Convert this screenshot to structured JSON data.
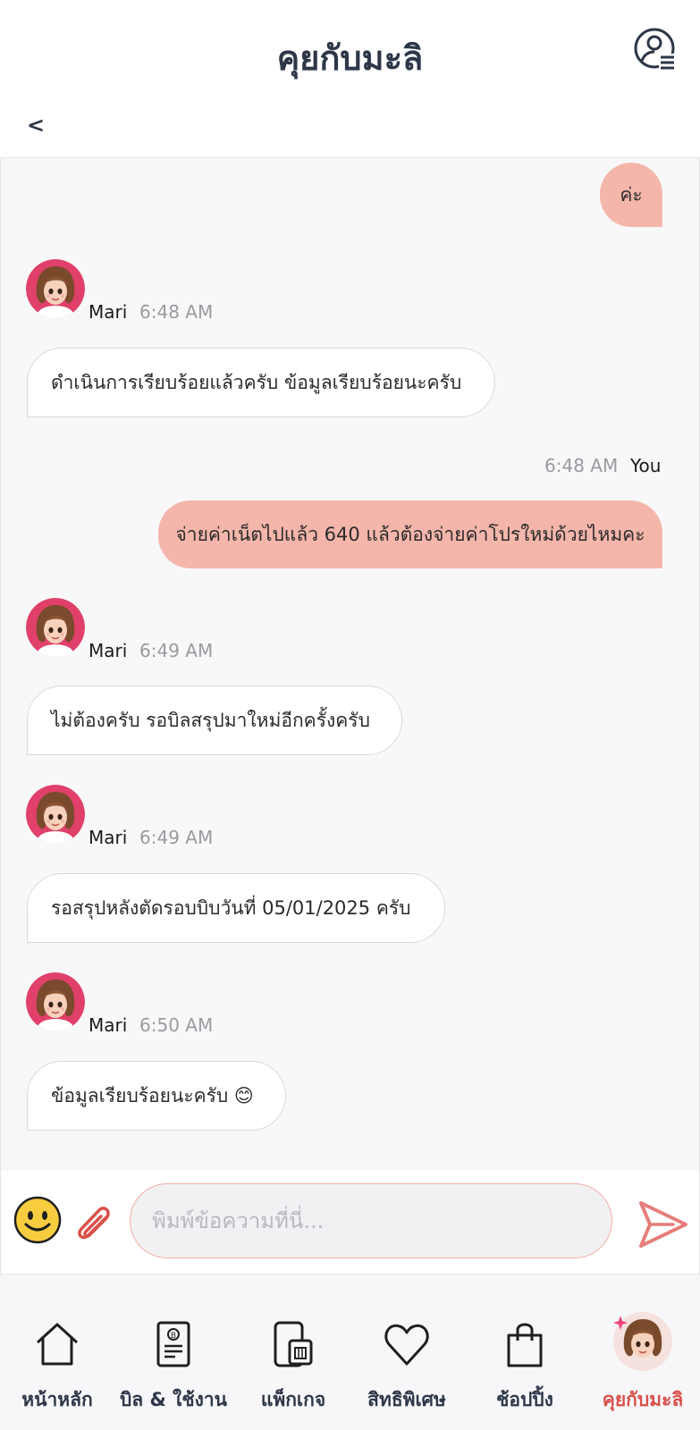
{
  "header": {
    "title": "คุยกับมะลิ",
    "back_label": "<"
  },
  "messages": [
    {
      "from": "You",
      "text": "ค่ะ"
    },
    {
      "from": "Mari",
      "sender": "Mari",
      "time": "6:48 AM",
      "text": "ดำเนินการเรียบร้อยแล้วครับ ข้อมูลเรียบร้อยนะครับ"
    },
    {
      "from": "You",
      "sender": "You",
      "time": "6:48 AM",
      "text": "จ่ายค่าเน็ตไปแล้ว 640 แล้วต้องจ่ายค่าโปรใหม่ด้วยไหมคะ"
    },
    {
      "from": "Mari",
      "sender": "Mari",
      "time": "6:49 AM",
      "text": "ไม่ต้องครับ รอบิลสรุปมาใหม่อีกครั้งครับ"
    },
    {
      "from": "Mari",
      "sender": "Mari",
      "time": "6:49 AM",
      "text": "รอสรุปหลังตัดรอบบิบวันที่ 05/01/2025 ครับ"
    },
    {
      "from": "Mari",
      "sender": "Mari",
      "time": "6:50 AM",
      "text": "ข้อมูลเรียบร้อยนะครับ 😊"
    }
  ],
  "composer": {
    "placeholder": "พิมพ์ข้อความที่นี่..."
  },
  "nav": [
    {
      "label": "หน้าหลัก",
      "icon": "home-icon"
    },
    {
      "label": "บิล & ใช้งาน",
      "icon": "bill-icon"
    },
    {
      "label": "แพ็กเกจ",
      "icon": "sim-phone-icon"
    },
    {
      "label": "สิทธิพิเศษ",
      "icon": "heart-icon"
    },
    {
      "label": "ช้อปปิ้ง",
      "icon": "shopping-bag-icon"
    },
    {
      "label": "คุยกับมะลิ",
      "icon": "mali-avatar-icon",
      "active": true
    }
  ],
  "colors": {
    "accent": "#d9514a",
    "outgoing_bubble": "#f4b6ab",
    "dark_text": "#2d3748"
  }
}
